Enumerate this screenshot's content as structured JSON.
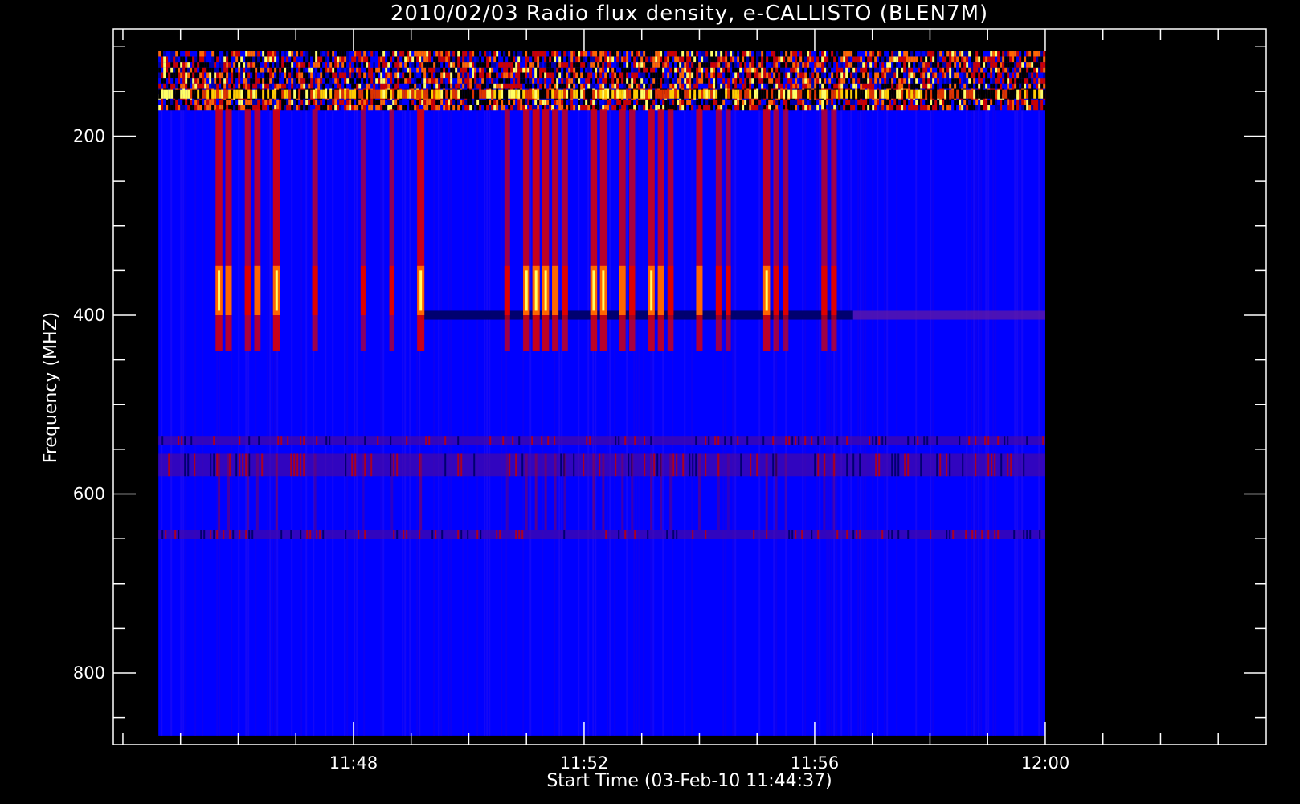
{
  "chart_data": {
    "type": "heatmap",
    "title": "2010/02/03  Radio flux density, e-CALLISTO (BLEN7M)",
    "xlabel": "Start Time (03-Feb-10 11:44:37)",
    "ylabel": "Frequency (MHZ)",
    "x_axis": {
      "unit": "minutes",
      "range": [
        "11:43:50",
        "12:03:50"
      ],
      "data_range": [
        "11:44:37",
        "12:00:00"
      ],
      "major_ticks": [
        "11:48",
        "11:52",
        "11:56",
        "12:00"
      ],
      "minor_tick_interval_min": 1
    },
    "y_axis": {
      "unit": "MHz",
      "inverted": true,
      "range": [
        80,
        880
      ],
      "data_range": [
        105,
        870
      ],
      "major_ticks": [
        200,
        400,
        600,
        800
      ],
      "minor_tick_interval": 50
    },
    "colormap": "blue-red-yellow",
    "colors": {
      "background": "#0000ff",
      "low": "#000070",
      "mid": "#dd0000",
      "high": "#ff6600",
      "peak": "#ffff66"
    },
    "features": {
      "interference_band_top_mhz": [
        105,
        170
      ],
      "bright_band_mhz": [
        148,
        158
      ],
      "dark_band_mhz": [
        395,
        405
      ],
      "weak_bands_mhz": [
        [
          535,
          545
        ],
        [
          555,
          580
        ],
        [
          640,
          650
        ]
      ],
      "burst_frequency_range_mhz": [
        170,
        440
      ],
      "burst_peak_mhz": [
        345,
        400
      ],
      "bursts": [
        {
          "time": "11:45:40",
          "strength": 0.9
        },
        {
          "time": "11:45:50",
          "strength": 0.8
        },
        {
          "time": "11:46:10",
          "strength": 0.7
        },
        {
          "time": "11:46:20",
          "strength": 0.75
        },
        {
          "time": "11:46:40",
          "strength": 1.0
        },
        {
          "time": "11:47:20",
          "strength": 0.6
        },
        {
          "time": "11:48:10",
          "strength": 0.4
        },
        {
          "time": "11:48:40",
          "strength": 0.5
        },
        {
          "time": "11:49:10",
          "strength": 1.0
        },
        {
          "time": "11:50:40",
          "strength": 0.6
        },
        {
          "time": "11:51:00",
          "strength": 0.85
        },
        {
          "time": "11:51:10",
          "strength": 1.0
        },
        {
          "time": "11:51:20",
          "strength": 0.9
        },
        {
          "time": "11:51:30",
          "strength": 0.8
        },
        {
          "time": "11:51:40",
          "strength": 0.7
        },
        {
          "time": "11:52:10",
          "strength": 0.9
        },
        {
          "time": "11:52:20",
          "strength": 0.85
        },
        {
          "time": "11:52:40",
          "strength": 0.75
        },
        {
          "time": "11:52:50",
          "strength": 0.7
        },
        {
          "time": "11:53:10",
          "strength": 0.85
        },
        {
          "time": "11:53:20",
          "strength": 0.8
        },
        {
          "time": "11:53:30",
          "strength": 0.7
        },
        {
          "time": "11:54:00",
          "strength": 0.8
        },
        {
          "time": "11:54:20",
          "strength": 0.6
        },
        {
          "time": "11:54:30",
          "strength": 0.5
        },
        {
          "time": "11:55:10",
          "strength": 0.9
        },
        {
          "time": "11:55:20",
          "strength": 0.6
        },
        {
          "time": "11:55:30",
          "strength": 0.5
        },
        {
          "time": "11:56:10",
          "strength": 0.65
        },
        {
          "time": "11:56:20",
          "strength": 0.6
        }
      ]
    }
  }
}
